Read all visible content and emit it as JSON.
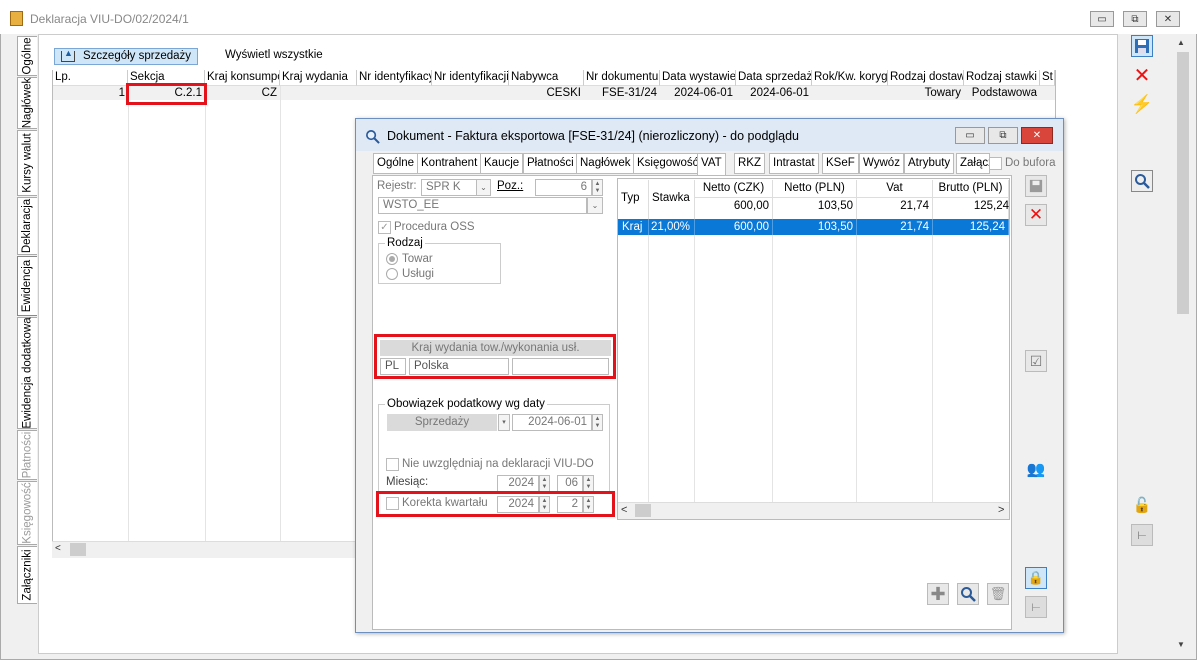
{
  "window": {
    "title": "Deklaracja VIU-DO/02/2024/1",
    "minimize": "▭",
    "restore": "⧉",
    "close": "✕"
  },
  "side_tabs": [
    "Ogólne",
    "Nagłówek",
    "Kursy walut",
    "Deklaracja",
    "Ewidencja",
    "Ewidencja dodatkowa",
    "Płatności",
    "Księgowość",
    "Załączniki"
  ],
  "toolbar": {
    "details_label": "Szczegóły sprzedaży",
    "show_all_label": "Wyświetl wszystkie"
  },
  "grid": {
    "columns": [
      "Lp.",
      "Sekcja",
      "Kraj konsumpc",
      "Kraj wydania",
      "Nr identyfikacy",
      "Nr identyfikacji",
      "Nabywca",
      "Nr dokumentu",
      "Data wystawie",
      "Data sprzedaż",
      "Rok/Kw. koryg",
      "Rodzaj dostaw",
      "Rodzaj stawki",
      "St"
    ],
    "rows": [
      {
        "lp": "1",
        "sekcja": "C.2.1",
        "kraj_konsumpcji": "CZ",
        "kraj_wydania": "",
        "nr_ident1": "",
        "nr_ident2": "",
        "nabywca": "CESKI",
        "nr_dokumentu": "FSE-31/24",
        "data_wystawienia": "2024-06-01",
        "data_sprzedazy": "2024-06-01",
        "rok_kw": "",
        "rodzaj_dostawy": "Towary",
        "rodzaj_stawki": "Podstawowa",
        "st": ""
      }
    ]
  },
  "dialog": {
    "title": "Dokument - Faktura eksportowa [FSE-31/24] (nierozliczony) - do podglądu",
    "tabs": [
      "Ogólne",
      "Kontrahent",
      "Kaucje",
      "Płatności",
      "Nagłówek",
      "Księgowość",
      "VAT",
      "RKZ",
      "Intrastat",
      "KSeF",
      "Wywóz",
      "Atrybuty",
      "Załącz"
    ],
    "active_tab": "VAT",
    "do_bufora": "Do bufora",
    "rejestr_label": "Rejestr:",
    "rejestr_value": "SPR K",
    "poz_label": "Poz.:",
    "poz_value": "6",
    "register_name": "WSTO_EE",
    "procedura_oss": "Procedura OSS",
    "rodzaj_label": "Rodzaj",
    "rodzaj_towar": "Towar",
    "rodzaj_uslugi": "Usługi",
    "kraj_header": "Kraj wydania tow./wykonania usł.",
    "kraj_code": "PL",
    "kraj_name": "Polska",
    "kraj_extra": "",
    "obowiazek_label": "Obowiązek podatkowy wg daty",
    "obowiazek_type": "Sprzedaży",
    "obowiazek_date": "2024-06-01",
    "nie_uwzgledniaj": "Nie uwzględniaj na deklaracji VIU-DO",
    "miesiac_label": "Miesiąc:",
    "miesiac_year": "2024",
    "miesiac_month": "06",
    "korekta_label": "Korekta kwartału",
    "korekta_year": "2024",
    "korekta_quarter": "2"
  },
  "vat_table": {
    "columns": [
      "Typ",
      "Stawka",
      "Netto (CZK)",
      "Netto (PLN)",
      "Vat",
      "Brutto (PLN)"
    ],
    "totals": {
      "netto_czk": "600,00",
      "netto_pln": "103,50",
      "vat": "21,74",
      "brutto": "125,24"
    },
    "rows": [
      {
        "typ": "Kraj",
        "stawka": "21,00%",
        "netto_czk": "600,00",
        "netto_pln": "103,50",
        "vat": "21,74",
        "brutto": "125,24"
      }
    ]
  },
  "colors": {
    "highlight_red": "#e3121b",
    "selection_blue": "#0a78d7",
    "tab_bg": "#cfe6f8"
  }
}
